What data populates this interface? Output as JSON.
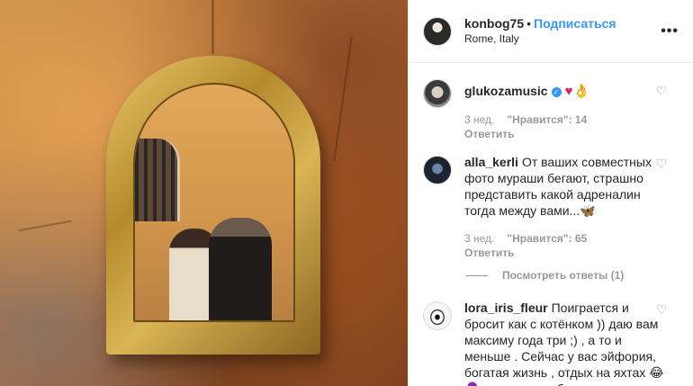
{
  "post": {
    "username": "konbog75",
    "separator": "•",
    "follow_label": "Подписаться",
    "location": "Rome, Italy",
    "more_icon": "more-options-icon"
  },
  "comments": [
    {
      "username": "glukozamusic",
      "verified": true,
      "text": "♥👌",
      "time": "3 нед.",
      "likes": "\"Нравится\": 14",
      "reply": "Ответить"
    },
    {
      "username": "alla_kerli",
      "verified": false,
      "text": "От ваших совместных фото мураши бегают, страшно представить какой адреналин тогда между вами...🦋",
      "time": "3 нед.",
      "likes": "\"Нравится\": 65",
      "reply": "Ответить",
      "view_replies": "Посмотреть ответы (1)"
    },
    {
      "username": "lora_iris_fleur",
      "verified": false,
      "text": "Поиграется и бросит как с котёнком )) даю вам максиму года три ;) , а то и меньше . Сейчас у вас эйфория, богатая жизнь , отдых на яхтах 😂🧕 , но чувства быстро"
    }
  ],
  "colors": {
    "link": "#3897f0",
    "muted": "#999999",
    "text": "#262626"
  }
}
